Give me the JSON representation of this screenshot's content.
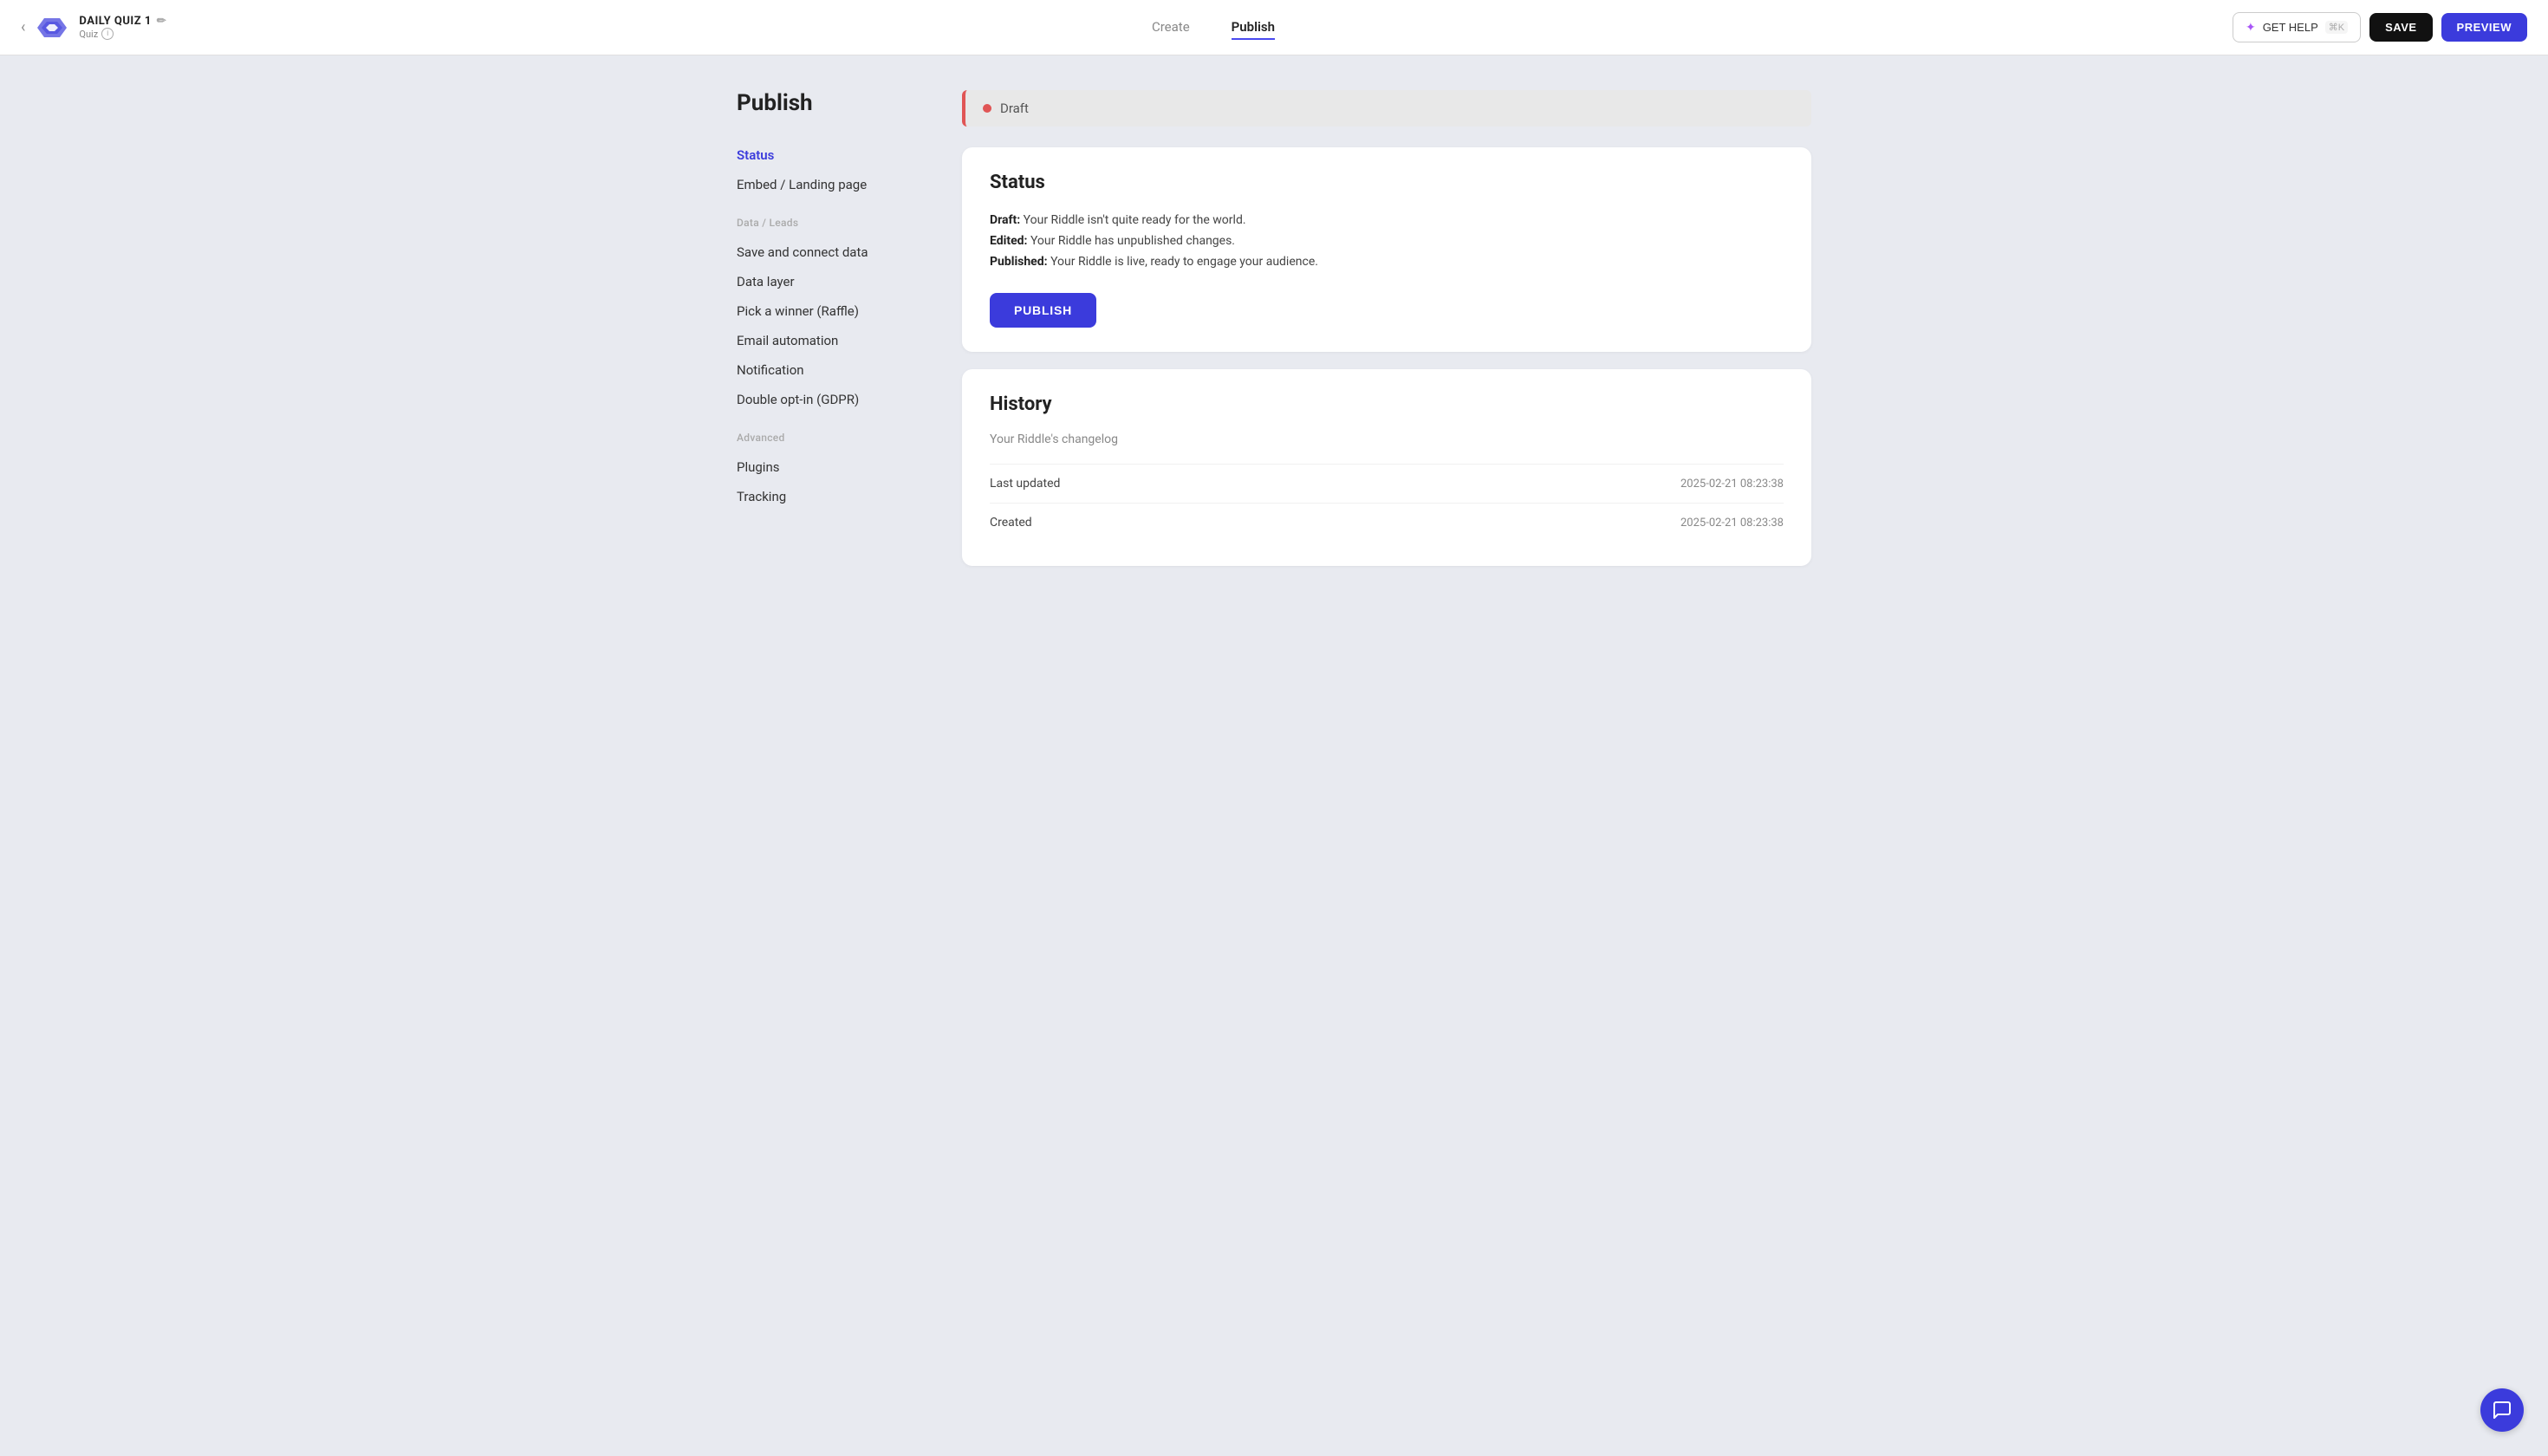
{
  "header": {
    "back_label": "‹",
    "title": "DAILY QUIZ 1",
    "edit_icon": "✏",
    "subtitle": "Quiz",
    "info_icon": "i",
    "nav": [
      {
        "label": "Create",
        "active": false
      },
      {
        "label": "Publish",
        "active": true
      }
    ],
    "get_help_label": "GET HELP",
    "get_help_shortcut": "⌘K",
    "save_label": "SAVE",
    "preview_label": "PREVIEW"
  },
  "sidebar": {
    "title": "Publish",
    "items": [
      {
        "label": "Status",
        "active": true,
        "section": null
      },
      {
        "label": "Embed / Landing page",
        "active": false,
        "section": null
      },
      {
        "label": "Save and connect data",
        "active": false,
        "section": "Data / Leads"
      },
      {
        "label": "Data layer",
        "active": false,
        "section": null
      },
      {
        "label": "Pick a winner (Raffle)",
        "active": false,
        "section": null
      },
      {
        "label": "Email automation",
        "active": false,
        "section": null
      },
      {
        "label": "Notification",
        "active": false,
        "section": null
      },
      {
        "label": "Double opt-in (GDPR)",
        "active": false,
        "section": null
      },
      {
        "label": "Plugins",
        "active": false,
        "section": "Advanced"
      },
      {
        "label": "Tracking",
        "active": false,
        "section": null
      }
    ]
  },
  "draft_bar": {
    "label": "Draft"
  },
  "status_card": {
    "title": "Status",
    "draft_label": "Draft:",
    "draft_text": "Your Riddle isn't quite ready for the world.",
    "edited_label": "Edited:",
    "edited_text": "Your Riddle has unpublished changes.",
    "published_label": "Published:",
    "published_text": "Your Riddle is live, ready to engage your audience.",
    "publish_button": "PUBLISH"
  },
  "history_card": {
    "title": "History",
    "subtitle": "Your Riddle's changelog",
    "last_updated_label": "Last updated",
    "last_updated_value": "2025-02-21 08:23:38",
    "created_label": "Created",
    "created_value": "2025-02-21 08:23:38"
  },
  "colors": {
    "accent": "#3b3bdc",
    "draft_dot": "#e05555"
  }
}
